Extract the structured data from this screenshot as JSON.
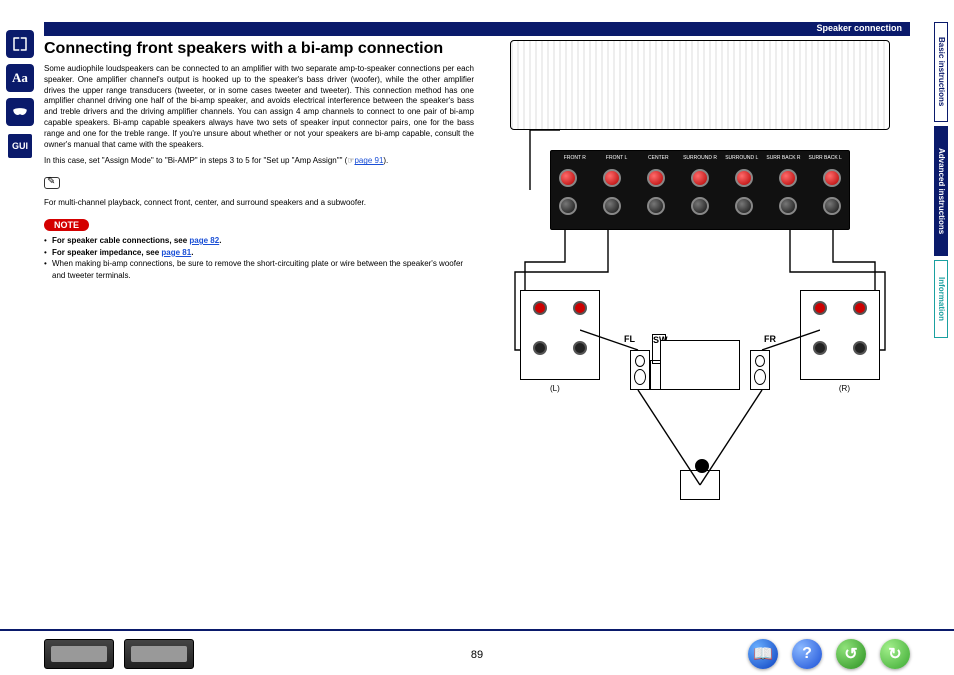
{
  "header": {
    "section": "Speaker connection"
  },
  "leftNav": {
    "items": [
      {
        "name": "book-icon",
        "glyph": "📖"
      },
      {
        "name": "aa-icon",
        "glyph": "Aa"
      },
      {
        "name": "mask-icon",
        "glyph": "👓"
      },
      {
        "name": "gui-icon",
        "glyph": "GUI"
      }
    ]
  },
  "content": {
    "title": "Connecting front speakers with a bi-amp connection",
    "para1": "Some audiophile loudspeakers can be connected to an amplifier with two separate amp-to-speaker connections per each speaker. One amplifier channel's output is hooked up to the speaker's bass driver (woofer), while the other amplifier drives the upper range transducers (tweeter, or in some cases tweeter and tweeter). This connection method has one amplifier channel driving one half of the bi-amp speaker, and avoids electrical interference between the speaker's bass and treble drivers and the driving amplifier channels. You can assign 4 amp channels to connect to one pair of bi-amp capable speakers. Bi-amp capable speakers always have two sets of speaker input connector pairs, one for the bass range and one for the treble range. If you're unsure about whether or not your speakers are bi-amp capable, consult the owner's manual that came with the speakers.",
    "para2_pre": "In this case, set \"Assign Mode\" to \"Bi-AMP\" in steps 3 to 5 for \"Set up \"Amp Assign\"\" (",
    "para2_link": "page 91",
    "para2_post": ").",
    "para3": "For multi-channel playback, connect front, center, and surround speakers and a subwoofer.",
    "noteLabel": "NOTE",
    "notes": [
      {
        "bold": "For speaker cable connections, see ",
        "link": "page 82",
        "tail": "."
      },
      {
        "bold": "For speaker impedance, see ",
        "link": "page 81",
        "tail": "."
      },
      {
        "plain": "When making bi-amp connections, be sure to remove the short-circuiting plate or wire between the speaker's woofer and tweeter terminals."
      }
    ]
  },
  "diagram": {
    "terminalLabels": [
      "FRONT R",
      "FRONT L",
      "CENTER",
      "SURROUND R",
      "SURROUND L",
      "SURR BACK R",
      "SURR BACK L"
    ],
    "room": {
      "fl": "FL",
      "sw": "SW",
      "fr": "FR",
      "lLabel": "(L)",
      "rLabel": "(R)"
    }
  },
  "rightTabs": {
    "a": "Basic instructions",
    "b": "Advanced instructions",
    "c": "Information"
  },
  "footer": {
    "pageNum": "89",
    "buttons": {
      "book": "📖",
      "help": "?",
      "back": "↺",
      "fwd": "↻"
    }
  }
}
